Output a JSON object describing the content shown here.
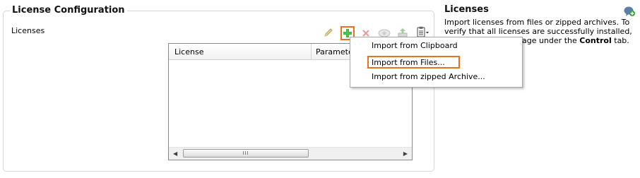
{
  "panel": {
    "title": "License Configuration",
    "licenses_label": "Licenses"
  },
  "toolbar": {
    "buttons": [
      {
        "icon": "pencil-icon",
        "enabled": false
      },
      {
        "icon": "add-icon",
        "enabled": true,
        "highlighted": true
      },
      {
        "icon": "delete-icon",
        "enabled": false
      },
      {
        "icon": "view-icon",
        "enabled": false
      },
      {
        "icon": "export-icon",
        "enabled": false
      },
      {
        "icon": "clipboard-menu-icon",
        "enabled": true
      }
    ]
  },
  "grid": {
    "columns": [
      "License",
      "Parameter"
    ],
    "scroll_thumb": "III"
  },
  "menu": {
    "items": [
      "Import from Clipboard",
      "Import from Files...",
      "Import from zipped Archive..."
    ],
    "highlighted_index": 1
  },
  "help": {
    "title": "Licenses",
    "line1": "Import licenses from files or zipped archives. To",
    "line2": "verify that all licenses are successfully installed,",
    "line3_prefix": "",
    "line3_visible": "age under the",
    "line3_bold": "Control",
    "line3_suffix": "tab."
  },
  "colors": {
    "highlight_border": "#e8731f",
    "add_green": "#3aa23a",
    "delete_red": "#d85a5a"
  }
}
